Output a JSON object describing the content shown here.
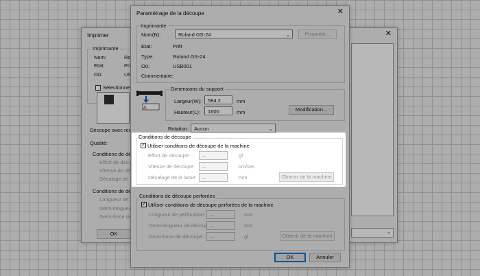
{
  "print_dialog": {
    "title": "Imprimer",
    "printer_group": "Imprimante",
    "name_label": "Nom:",
    "name_value": "Ro",
    "state_label": "Etat:",
    "state_value": "Prê",
    "where_label": "Où:",
    "where_value": "USI",
    "select_checkbox": "Sélectionner la",
    "cut_with_label": "Découpe avec recou",
    "quality_label": "Qualité:",
    "cut_conditions": "Conditions de décou",
    "force_label": "Effort de découp",
    "speed_label": "Vitesse de déco",
    "blade_label": "Décalage de la",
    "perf_conditions": "Conditions de décou",
    "perf_length": "Longueur de perfo",
    "half_length": "Demi-longueur de",
    "half_force": "Demi-force de dé",
    "ok_label": "OK"
  },
  "dialog": {
    "title": "Paramétrage de la découpe",
    "printer_group": "Imprimante",
    "name_label": "Nom(N):",
    "printer_name": "Roland GS-24",
    "properties_button": "Propriété...",
    "state_label": "Etat:",
    "state_value": "Prêt",
    "type_label": "Type:",
    "type_value": "Roland GS-24",
    "where_label": "Où:",
    "where_value": "USB001",
    "comment_label": "Commentaire:",
    "support_group": "Dimensions du support",
    "width_label": "Largeur(W):",
    "width_value": "584.2",
    "width_unit": "mm",
    "height_label": "Hauteur(L):",
    "height_value": "1600",
    "height_unit": "mm",
    "modification_button": "Modification...",
    "rotation_label": "Rotation:",
    "rotation_value": "Aucun",
    "cut_group": "Conditions de découpe",
    "cut_use_machine": "Utiliser conditions de découpe de la machine",
    "force_label": "Effort de découpe:",
    "force_value": "--",
    "force_unit": "gf",
    "speed_label": "Vitesse de découpe:",
    "speed_value": "--",
    "speed_unit": "cm/sec",
    "blade_label": "Décalage de la lame:",
    "blade_value": "--",
    "blade_unit": "mm",
    "get_machine_button": "Obtenir de la machine",
    "perf_group": "Conditions de découpe perforées",
    "perf_use_machine": "Utiliser conditions de découpe perforées de la machine",
    "perf_length_label": "Longueur de perforation:",
    "perf_length_value": "--",
    "perf_length_unit": "mm",
    "half_length_label": "Demi-longueur de découpe:",
    "half_length_value": "--",
    "half_length_unit": "mm",
    "half_force_label": "Demi-force de découpe:",
    "half_force_value": "--",
    "half_force_unit": "gf",
    "get_machine_button2": "Obtenir de la machine",
    "ok_button": "OK",
    "cancel_button": "Annuler"
  }
}
